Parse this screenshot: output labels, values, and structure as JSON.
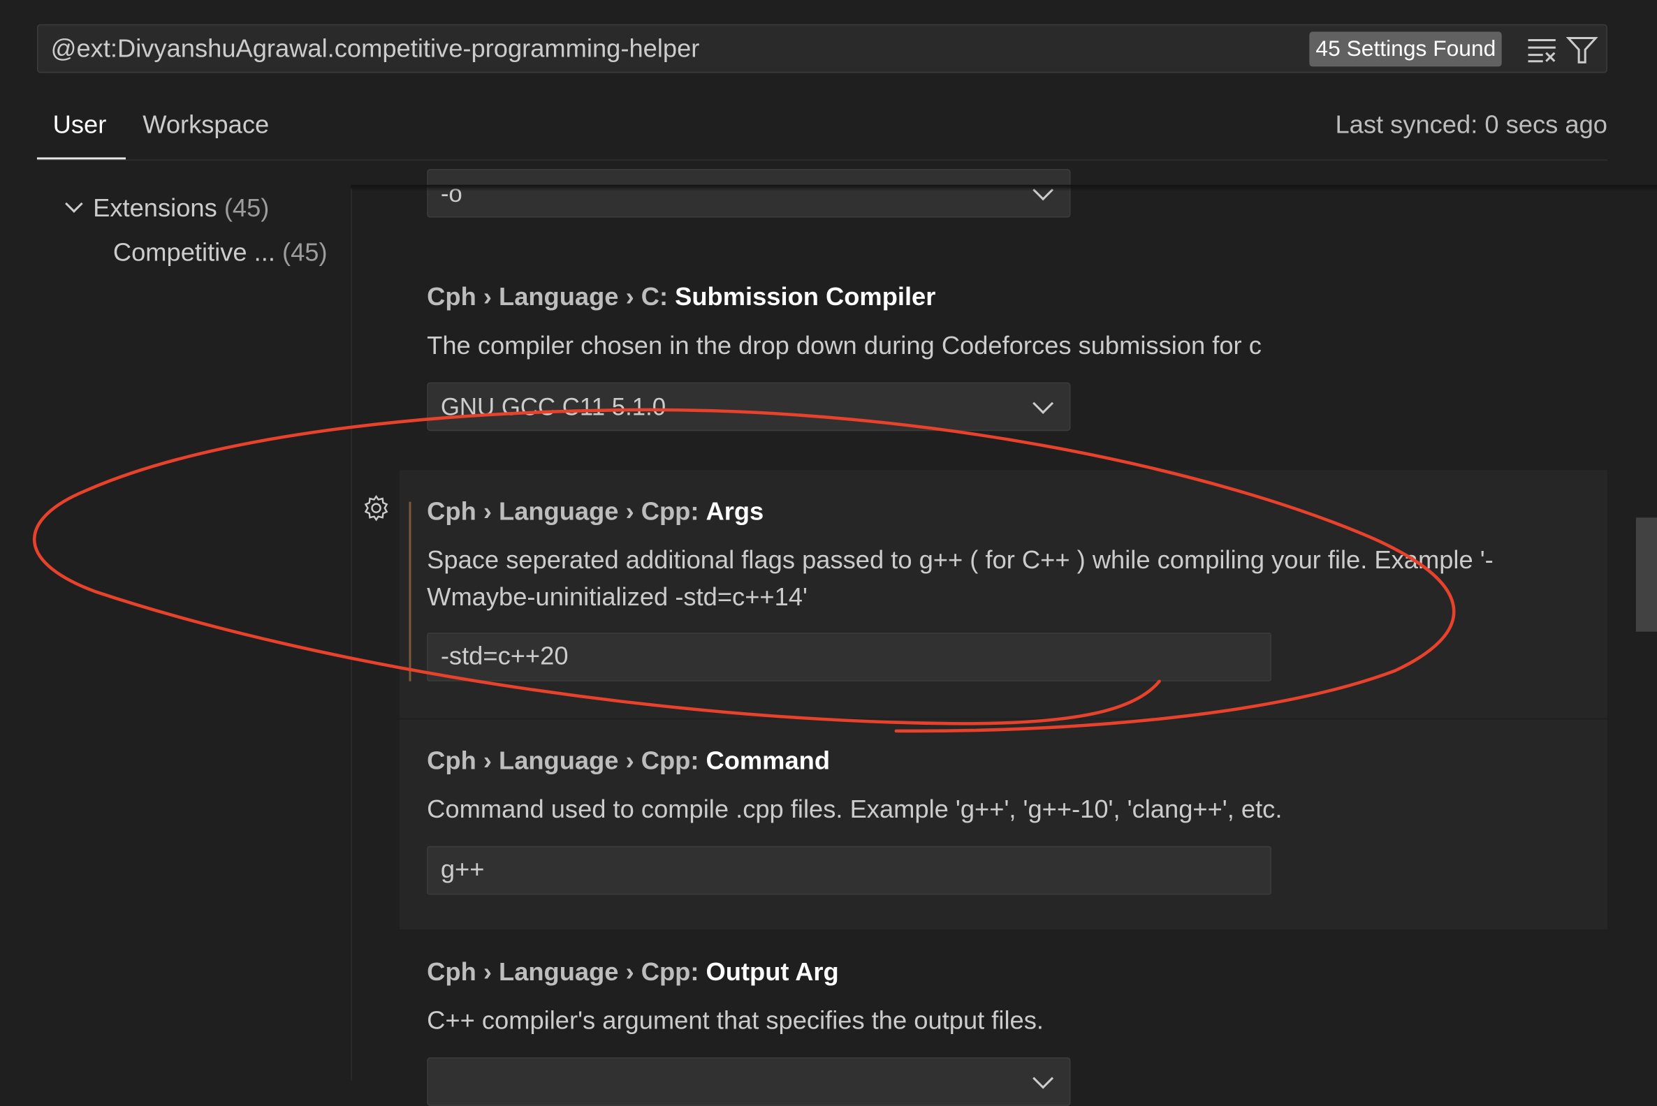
{
  "search": {
    "query": "@ext:DivyanshuAgrawal.competitive-programming-helper",
    "results_badge": "45 Settings Found",
    "clear_icon": "clear-filter-icon",
    "filter_icon": "funnel-icon"
  },
  "tabs": [
    {
      "label": "User",
      "active": true
    },
    {
      "label": "Workspace",
      "active": false
    }
  ],
  "sync_status": "Last synced: 0 secs ago",
  "tree": {
    "group": {
      "label": "Extensions",
      "count": "(45)"
    },
    "item": {
      "label": "Competitive ...",
      "count": "(45)"
    }
  },
  "settings": [
    {
      "value": "-o",
      "control": "dropdown"
    },
    {
      "prefix": "Cph › Language › C: ",
      "name": "Submission Compiler",
      "description": "The compiler chosen in the drop down during Codeforces submission for c",
      "value": "GNU GCC C11 5.1.0",
      "control": "dropdown"
    },
    {
      "prefix": "Cph › Language › Cpp: ",
      "name": "Args",
      "description": "Space seperated additional flags passed to g++ ( for C++ ) while compiling your file. Example '-Wmaybe-uninitialized -std=c++14'",
      "value": "-std=c++20",
      "control": "text",
      "focused": true,
      "modified": true
    },
    {
      "prefix": "Cph › Language › Cpp: ",
      "name": "Command",
      "description": "Command used to compile .cpp files. Example 'g++', 'g++-10', 'clang++', etc.",
      "value": "g++",
      "control": "text"
    },
    {
      "prefix": "Cph › Language › Cpp: ",
      "name": "Output Arg",
      "description": "C++ compiler's argument that specifies the output files.",
      "control": "dropdown"
    }
  ],
  "annotation": {
    "color": "#e8412c",
    "shape": "hand-drawn circle around Cpp: Args"
  },
  "colors": {
    "background": "#1f1f1f",
    "modified_indicator": "#7a5a3a"
  }
}
